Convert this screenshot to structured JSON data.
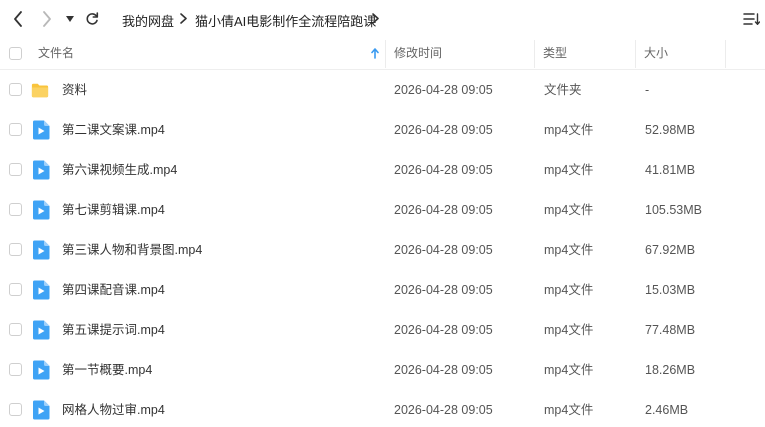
{
  "breadcrumb": {
    "root": "我的网盘",
    "folder": "猫小倩AI电影制作全流程陪跑课"
  },
  "columns": {
    "name": "文件名",
    "modified": "修改时间",
    "type": "类型",
    "size": "大小"
  },
  "files": [
    {
      "name": "资料",
      "modified": "2026-04-28 09:05",
      "type": "文件夹",
      "size": "-",
      "icon": "folder-icon"
    },
    {
      "name": "第二课文案课.mp4",
      "modified": "2026-04-28 09:05",
      "type": "mp4文件",
      "size": "52.98MB",
      "icon": "video-file-icon"
    },
    {
      "name": "第六课视频生成.mp4",
      "modified": "2026-04-28 09:05",
      "type": "mp4文件",
      "size": "41.81MB",
      "icon": "video-file-icon"
    },
    {
      "name": "第七课剪辑课.mp4",
      "modified": "2026-04-28 09:05",
      "type": "mp4文件",
      "size": "105.53MB",
      "icon": "video-file-icon"
    },
    {
      "name": "第三课人物和背景图.mp4",
      "modified": "2026-04-28 09:05",
      "type": "mp4文件",
      "size": "67.92MB",
      "icon": "video-file-icon"
    },
    {
      "name": "第四课配音课.mp4",
      "modified": "2026-04-28 09:05",
      "type": "mp4文件",
      "size": "15.03MB",
      "icon": "video-file-icon"
    },
    {
      "name": "第五课提示词.mp4",
      "modified": "2026-04-28 09:05",
      "type": "mp4文件",
      "size": "77.48MB",
      "icon": "video-file-icon"
    },
    {
      "name": "第一节概要.mp4",
      "modified": "2026-04-28 09:05",
      "type": "mp4文件",
      "size": "18.26MB",
      "icon": "video-file-icon"
    },
    {
      "name": "网格人物过审.mp4",
      "modified": "2026-04-28 09:05",
      "type": "mp4文件",
      "size": "2.46MB",
      "icon": "video-file-icon"
    }
  ],
  "colors": {
    "accent": "#3a9af0",
    "folder": "#f9c43c",
    "video": "#3fa3f5"
  }
}
